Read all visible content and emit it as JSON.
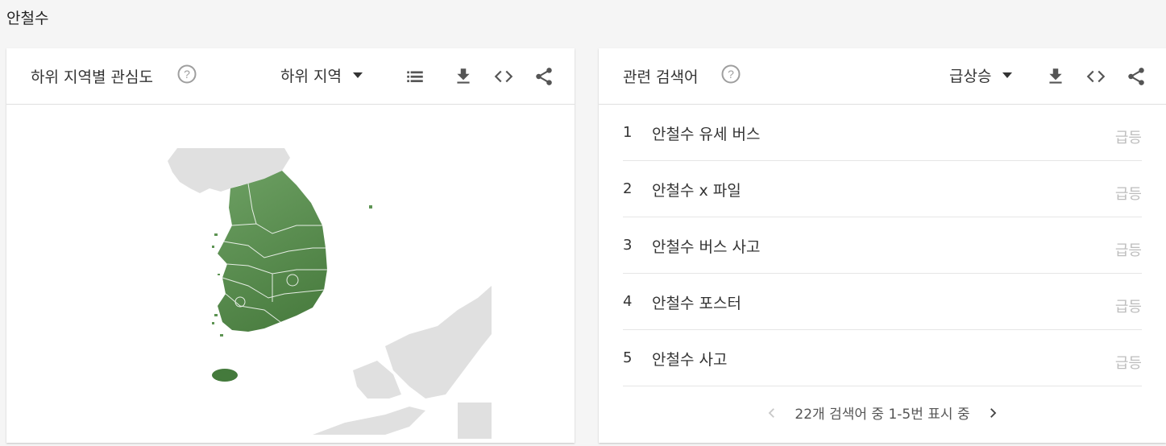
{
  "page": {
    "title": "안철수"
  },
  "region_card": {
    "title": "하위 지역별 관심도",
    "dropdown_label": "하위 지역",
    "icons": [
      "help-icon",
      "list-icon",
      "download-icon",
      "embed-code-icon",
      "share-icon"
    ],
    "colors": {
      "map_fill": "#5d9453",
      "map_land": "#e0e0e0",
      "jeju": "#447a3c"
    }
  },
  "related_card": {
    "title": "관련 검색어",
    "dropdown_label": "급상승",
    "rows": [
      {
        "rank": "1",
        "term": "안철수 유세 버스",
        "badge": "급등"
      },
      {
        "rank": "2",
        "term": "안철수 x 파일",
        "badge": "급등"
      },
      {
        "rank": "3",
        "term": "안철수 버스 사고",
        "badge": "급등"
      },
      {
        "rank": "4",
        "term": "안철수 포스터",
        "badge": "급등"
      },
      {
        "rank": "5",
        "term": "안철수 사고",
        "badge": "급등"
      }
    ],
    "pager_text": "22개 검색어 중 1-5번 표시 중"
  }
}
